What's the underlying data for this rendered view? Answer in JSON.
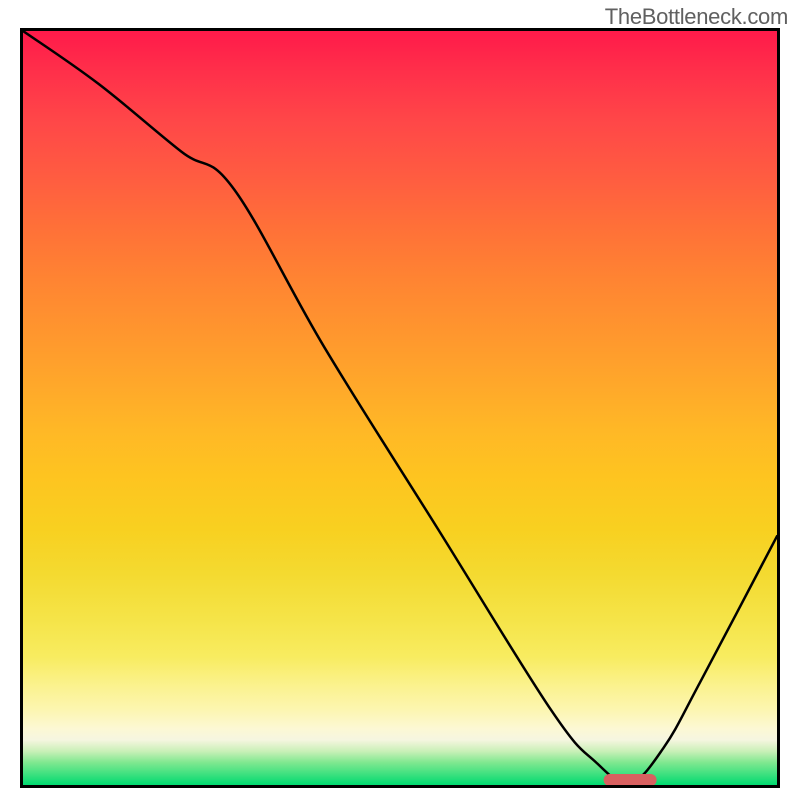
{
  "watermark": "TheBottleneck.com",
  "chart_data": {
    "type": "line",
    "title": "",
    "xlabel": "",
    "ylabel": "",
    "xlim": [
      0,
      100
    ],
    "ylim": [
      0,
      100
    ],
    "series": [
      {
        "name": "curve",
        "x": [
          0,
          10,
          21,
          28,
          40,
          55,
          70,
          76,
          80.5,
          85,
          90,
          100
        ],
        "y": [
          100,
          93,
          84,
          79,
          58,
          34,
          10,
          3,
          0.3,
          5,
          14,
          33
        ]
      }
    ],
    "marker": {
      "x_center": 80.5,
      "y": 0.6,
      "x_width": 7
    },
    "colors": {
      "gradient_top": "#ff1a4a",
      "gradient_bottom": "#00da70",
      "curve": "#000000",
      "marker": "#d86060",
      "border": "#000000"
    }
  }
}
